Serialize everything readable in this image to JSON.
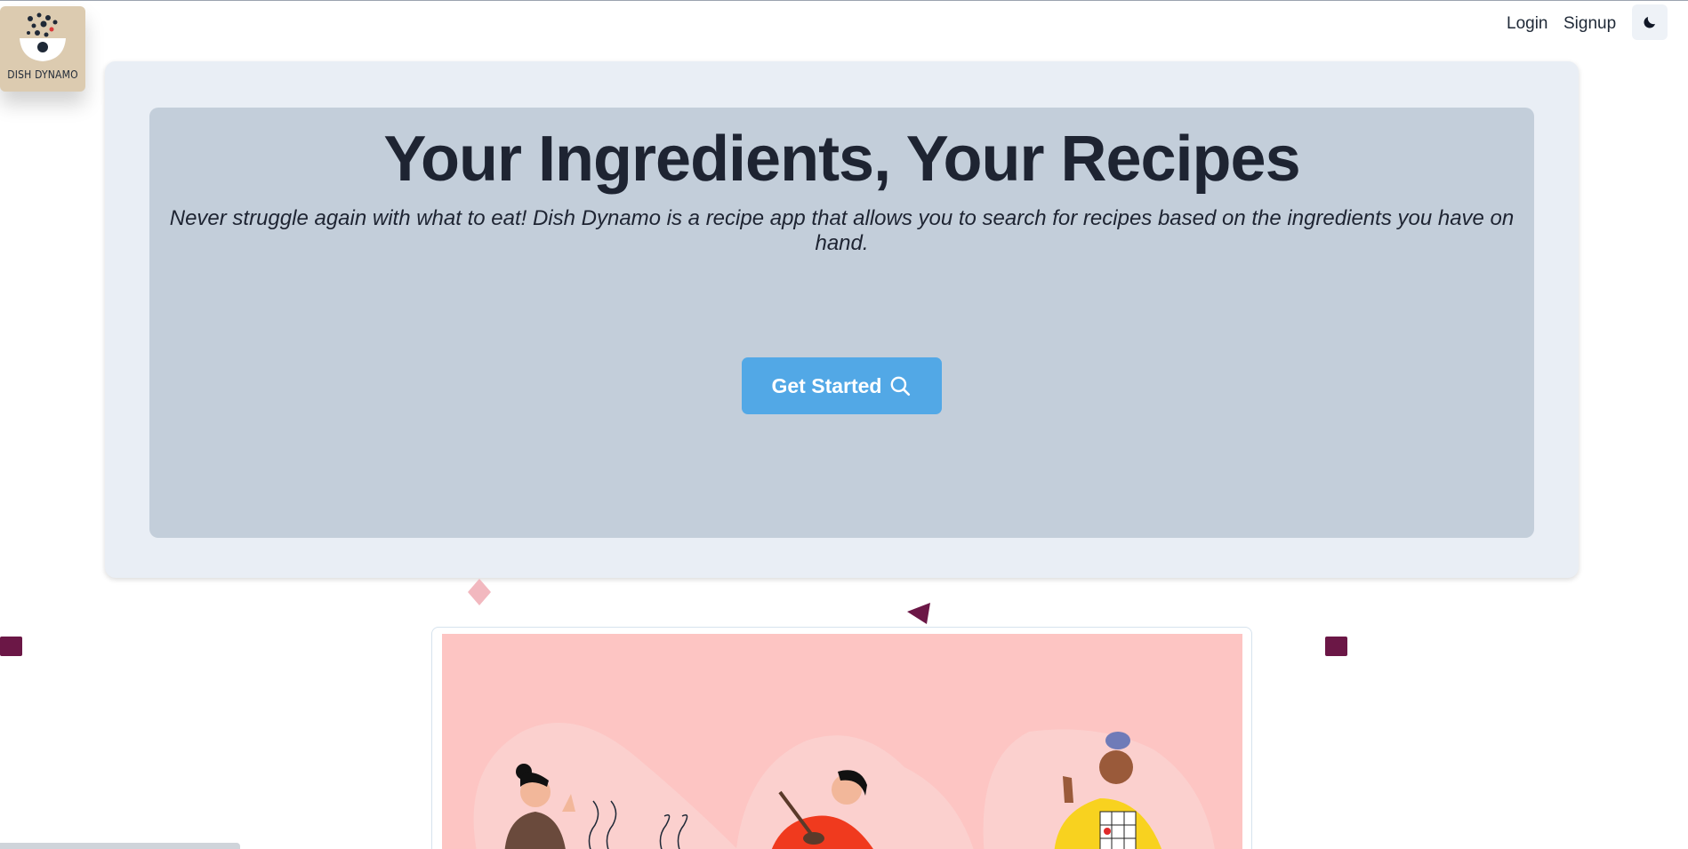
{
  "logo": {
    "text": "DISH DYNAMO"
  },
  "nav": {
    "login": "Login",
    "signup": "Signup",
    "theme_icon": "moon-icon"
  },
  "hero": {
    "title": "Your Ingredients, Your Recipes",
    "subtitle": "Never struggle again with what to eat! Dish Dynamo is a recipe app that allows you to search for recipes based on the ingredients you have on hand.",
    "cta_label": "Get Started",
    "cta_icon": "search-icon"
  },
  "colors": {
    "accent": "#52a8e6",
    "hero_outer": "#e9eef5",
    "hero_inner": "#c3ceda",
    "shape_dark": "#6b1746",
    "shape_pink": "#f2b8bf",
    "illustration_bg": "#fdc5c3"
  }
}
